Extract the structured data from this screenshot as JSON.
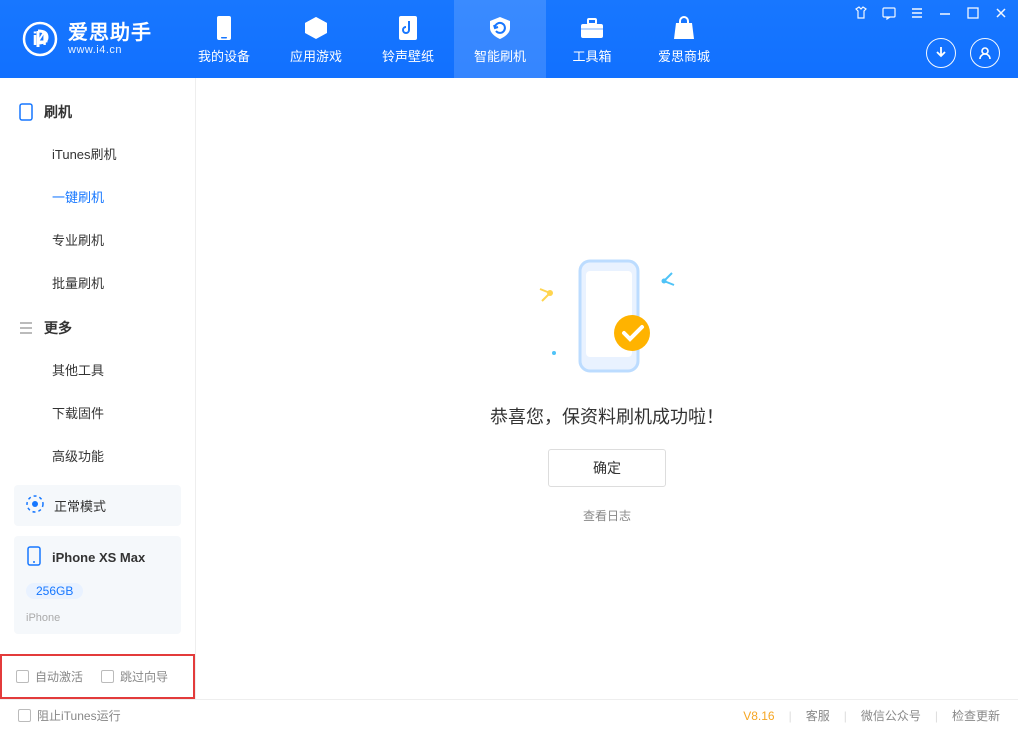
{
  "app": {
    "title": "爱思助手",
    "subtitle": "www.i4.cn"
  },
  "nav": {
    "items": [
      {
        "label": "我的设备"
      },
      {
        "label": "应用游戏"
      },
      {
        "label": "铃声壁纸"
      },
      {
        "label": "智能刷机"
      },
      {
        "label": "工具箱"
      },
      {
        "label": "爱思商城"
      }
    ],
    "active_index": 3
  },
  "sidebar": {
    "groups": [
      {
        "title": "刷机",
        "icon": "device-icon",
        "items": [
          "iTunes刷机",
          "一键刷机",
          "专业刷机",
          "批量刷机"
        ],
        "active_index": 1
      },
      {
        "title": "更多",
        "icon": "list-icon",
        "items": [
          "其他工具",
          "下载固件",
          "高级功能"
        ],
        "active_index": -1
      }
    ],
    "mode_card": {
      "label": "正常模式"
    },
    "device_card": {
      "name": "iPhone XS Max",
      "capacity": "256GB",
      "type": "iPhone"
    },
    "options": {
      "auto_activate": "自动激活",
      "skip_guide": "跳过向导"
    }
  },
  "main": {
    "message": "恭喜您，保资料刷机成功啦！",
    "ok": "确定",
    "view_log": "查看日志"
  },
  "footer": {
    "block_itunes": "阻止iTunes运行",
    "version": "V8.16",
    "links": [
      "客服",
      "微信公众号",
      "检查更新"
    ]
  }
}
